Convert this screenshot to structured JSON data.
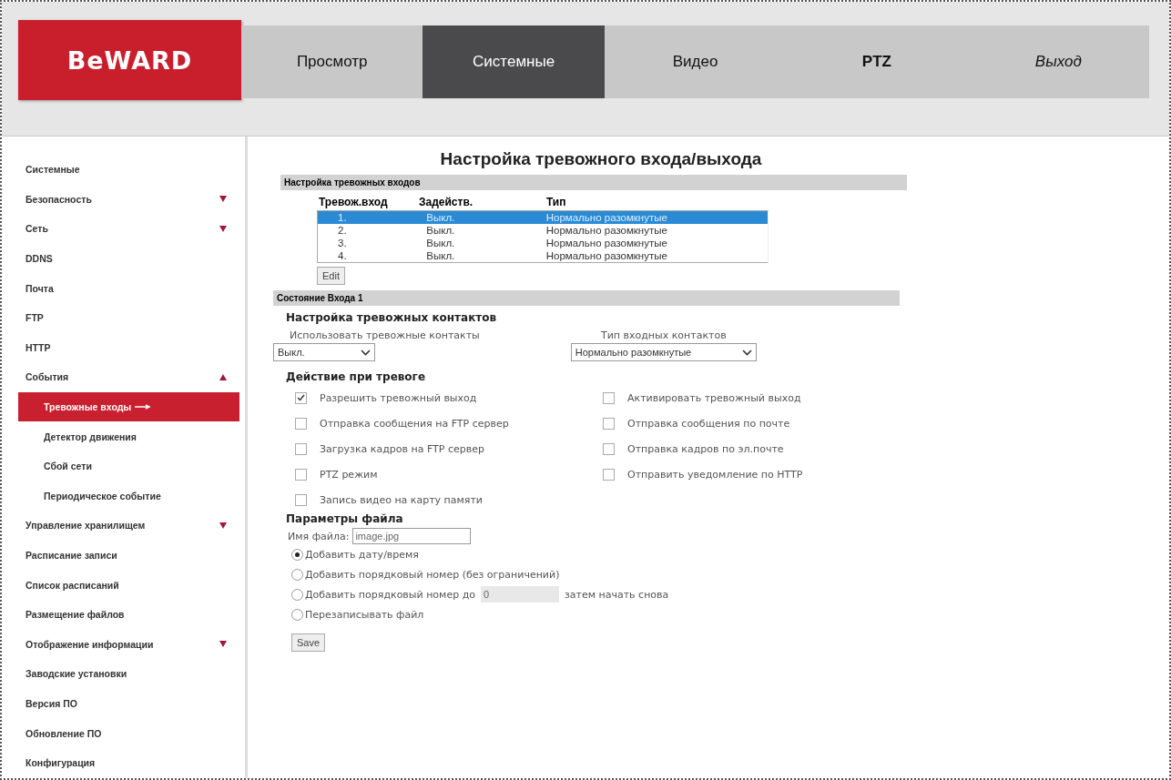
{
  "logo": {
    "name": "BeWARD"
  },
  "nav": [
    {
      "label": "Просмотр",
      "selected": false,
      "kind": "page"
    },
    {
      "label": "Системные",
      "selected": true,
      "kind": "page"
    },
    {
      "label": "Видео",
      "selected": false,
      "kind": "page"
    },
    {
      "label": "PTZ",
      "selected": false,
      "kind": "ptz"
    },
    {
      "label": "Выход",
      "selected": false,
      "kind": "exit"
    }
  ],
  "sidebar": {
    "items": [
      {
        "label": "Системные",
        "selected": false
      },
      {
        "label": "Безопасность",
        "selected": false,
        "expanded": false
      },
      {
        "label": "Сеть",
        "selected": false,
        "expanded": false
      },
      {
        "label": "DDNS",
        "selected": false
      },
      {
        "label": "Почта",
        "selected": false
      },
      {
        "label": "FTP",
        "selected": false
      },
      {
        "label": "HTTP",
        "selected": false
      },
      {
        "label": "События",
        "selected": false,
        "expanded": true,
        "children": [
          {
            "label": "Тревожные входы",
            "selected": true
          },
          {
            "label": "Детектор движения",
            "selected": false
          },
          {
            "label": "Сбой сети",
            "selected": false
          },
          {
            "label": "Периодическое событие",
            "selected": false
          }
        ]
      },
      {
        "label": "Управление хранилищем",
        "selected": false,
        "expanded": false
      },
      {
        "label": "Расписание записи",
        "selected": false
      },
      {
        "label": "Список расписаний",
        "selected": false
      },
      {
        "label": "Размещение файлов",
        "selected": false
      },
      {
        "label": "Отображение информации",
        "selected": false,
        "expanded": false
      },
      {
        "label": "Заводские установки",
        "selected": false
      },
      {
        "label": "Версия ПО",
        "selected": false
      },
      {
        "label": "Обновление ПО",
        "selected": false
      },
      {
        "label": "Конфигурация",
        "selected": false
      }
    ]
  },
  "title": "Настройка тревожного входа/выхода",
  "inputs_section": {
    "title": "Настройка тревожных входов",
    "columns": [
      "Тревож.вход",
      "Задейств.",
      "Тип"
    ],
    "rows": [
      {
        "cells": [
          "1.",
          "Выкл.",
          "Нормально разомкнутые"
        ],
        "selected": true
      },
      {
        "cells": [
          "2.",
          "Выкл.",
          "Нормально разомкнутые"
        ],
        "selected": false
      },
      {
        "cells": [
          "3.",
          "Выкл.",
          "Нормально разомкнутые"
        ],
        "selected": false
      },
      {
        "cells": [
          "4.",
          "Выкл.",
          "Нормально разомкнутые"
        ],
        "selected": false
      }
    ],
    "button": "Edit"
  },
  "state_section": {
    "title": "Состояние Входа 1",
    "contacts_heading": "Настройка тревожных контактов",
    "use_contacts": {
      "label": "Использовать тревожные контакты",
      "value": "Выкл."
    },
    "contact_type": {
      "label": "Тип входных контактов",
      "value": "Нормально разомкнутые"
    },
    "actions_heading": "Действие при тревоге",
    "actions_left": [
      {
        "label": "Разрешить тревожный выход",
        "checked": true
      },
      {
        "label": "Отправка сообщения на FTP сервер",
        "checked": false
      },
      {
        "label": "Загрузка кадров на FTP сервер",
        "checked": false
      },
      {
        "label": "PTZ режим",
        "checked": false
      },
      {
        "label": "Запись видео на карту памяти",
        "checked": false
      }
    ],
    "actions_right": [
      {
        "label": "Активировать тревожный выход",
        "checked": false
      },
      {
        "label": "Отправка сообщения по почте",
        "checked": false
      },
      {
        "label": "Отправка кадров по эл.почте",
        "checked": false
      },
      {
        "label": "Отправить уведомление по HTTP",
        "checked": false
      }
    ],
    "file_heading": "Параметры файла",
    "file_name": {
      "label": "Имя файла:",
      "value": "image.jpg"
    },
    "naming": [
      {
        "kind": "plain",
        "label": "Добавить дату/время",
        "selected": true
      },
      {
        "kind": "plain",
        "label": "Добавить порядковый номер (без ограничений)",
        "selected": false
      },
      {
        "kind": "counter",
        "label": "Добавить порядковый номер до",
        "value": "0",
        "disabled": true,
        "suffix": "затем начать снова",
        "selected": false
      },
      {
        "kind": "plain",
        "label": "Перезаписывать файл",
        "selected": false
      }
    ],
    "button": "Save"
  }
}
